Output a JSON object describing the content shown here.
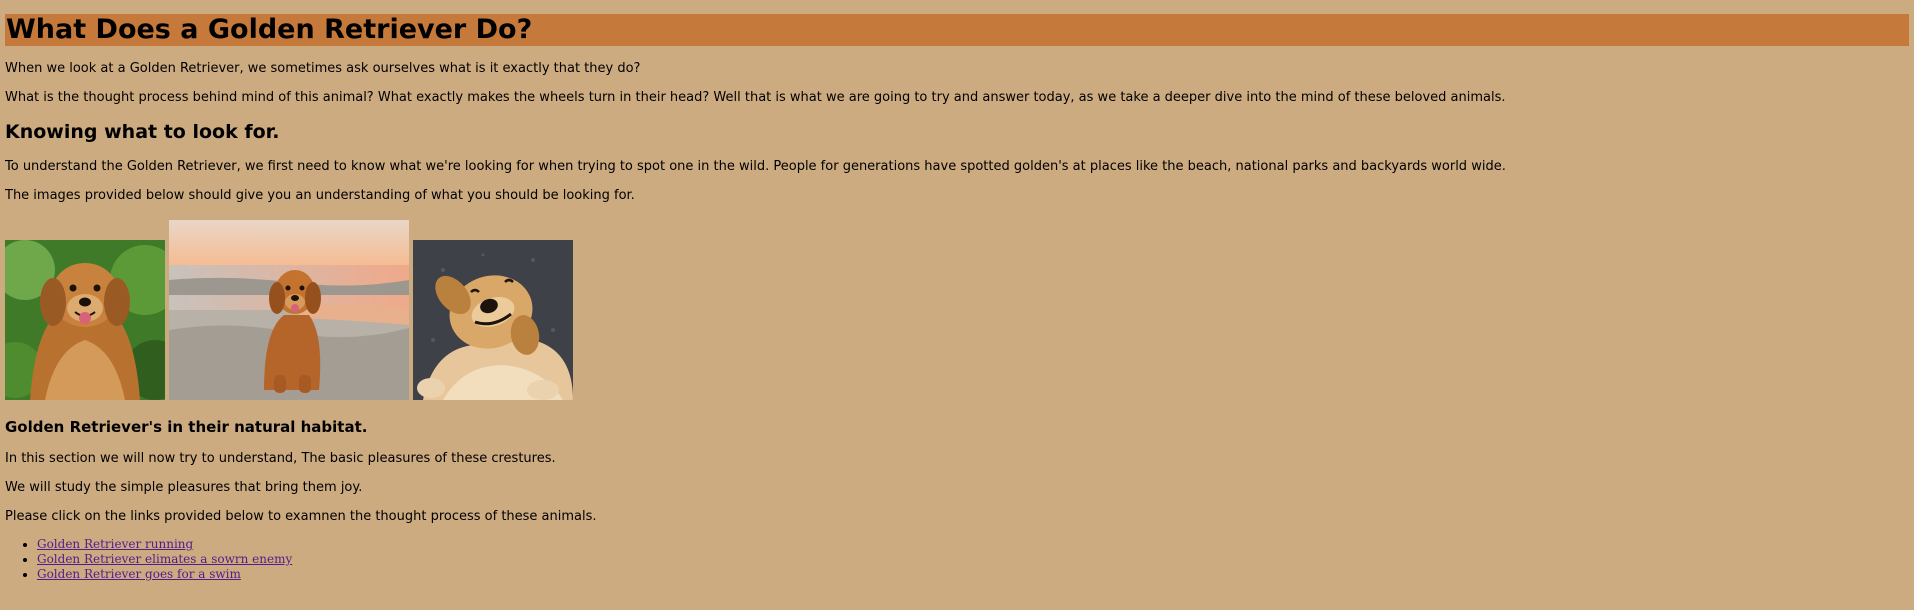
{
  "header": {
    "title": "What Does a Golden Retriever Do?"
  },
  "intro": {
    "paragraph_1": "When we look at a Golden Retriever, we sometimes ask ourselves what is it exactly that they do?",
    "paragraph_2": "What is the thought process behind mind of this animal? What exactly makes the wheels turn in their head? Well that is what we are going to try and answer today, as we take a deeper dive into the mind of these beloved animals."
  },
  "section_look": {
    "title": "Knowing what to look for.",
    "paragraph_1": "To understand the Golden Retriever, we first need to know what we're looking for when trying to spot one in the wild. People for generations have spotted golden's at places like the beach, national parks and backyards world wide.",
    "paragraph_2": "The images provided below should give you an understanding of what you should be looking for."
  },
  "gallery": {
    "images": [
      {
        "subject": "golden retriever sitting in green foliage"
      },
      {
        "subject": "golden retriever sitting on beach at sunset"
      },
      {
        "subject": "golden retriever lying on its back on dark ground"
      }
    ],
    "colors": {
      "fur": "#C27A3A",
      "fur_light": "#E3B279",
      "foliage": "#4E8A2E",
      "sand": "#A9A39A",
      "sky": "#F4C9A6",
      "asphalt": "#3E4148"
    }
  },
  "section_habitat": {
    "title": "Golden Retriever's in their natural habitat.",
    "paragraph_1": "In this section we will now try to understand, The basic pleasures of these crestures.",
    "paragraph_2": "We will study the simple pleasures that bring them joy.",
    "paragraph_3": "Please click on the links provided below to examnen the thought process of these animals."
  },
  "links": [
    {
      "label": "Golden Retriever running"
    },
    {
      "label": "Golden Retriever elimates a sowrn enemy"
    },
    {
      "label": "Golden Retriever goes for a swim"
    }
  ],
  "theme": {
    "background": "#CDAB81",
    "title_bar": "#C57A3B",
    "link_color": "#551A8B"
  }
}
